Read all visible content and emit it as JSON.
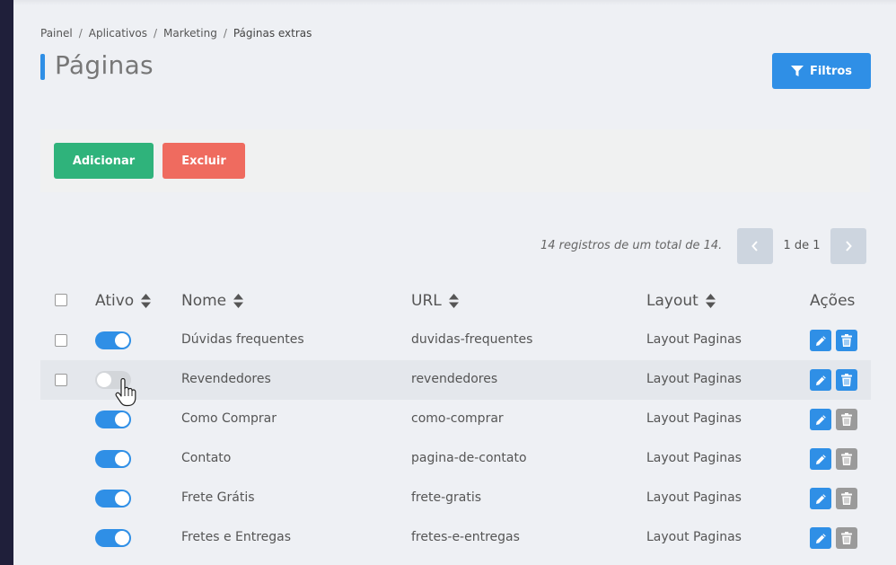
{
  "breadcrumb": [
    "Painel",
    "Aplicativos",
    "Marketing",
    "Páginas extras"
  ],
  "page": {
    "title": "Páginas"
  },
  "toolbar": {
    "filter_label": "Filtros",
    "add_label": "Adicionar",
    "delete_label": "Excluir"
  },
  "pagination": {
    "summary": "14 registros de um total de 14.",
    "label": "1 de 1"
  },
  "columns": {
    "active": "Ativo",
    "name": "Nome",
    "url": "URL",
    "layout": "Layout",
    "actions": "Ações"
  },
  "rows": [
    {
      "active": true,
      "name": "Dúvidas frequentes",
      "url": "duvidas-frequentes",
      "layout": "Layout Paginas",
      "selectable": true,
      "deletable": true
    },
    {
      "active": false,
      "name": "Revendedores",
      "url": "revendedores",
      "layout": "Layout Paginas",
      "selectable": true,
      "deletable": true
    },
    {
      "active": true,
      "name": "Como Comprar",
      "url": "como-comprar",
      "layout": "Layout Paginas",
      "selectable": false,
      "deletable": false
    },
    {
      "active": true,
      "name": "Contato",
      "url": "pagina-de-contato",
      "layout": "Layout Paginas",
      "selectable": false,
      "deletable": false
    },
    {
      "active": true,
      "name": "Frete Grátis",
      "url": "frete-gratis",
      "layout": "Layout Paginas",
      "selectable": false,
      "deletable": false
    },
    {
      "active": true,
      "name": "Fretes e Entregas",
      "url": "fretes-e-entregas",
      "layout": "Layout Paginas",
      "selectable": false,
      "deletable": false
    }
  ],
  "colors": {
    "primary": "#2f8fe6",
    "success": "#2fb37b",
    "danger": "#ef6b5f",
    "disabled": "#9a9a9a"
  }
}
